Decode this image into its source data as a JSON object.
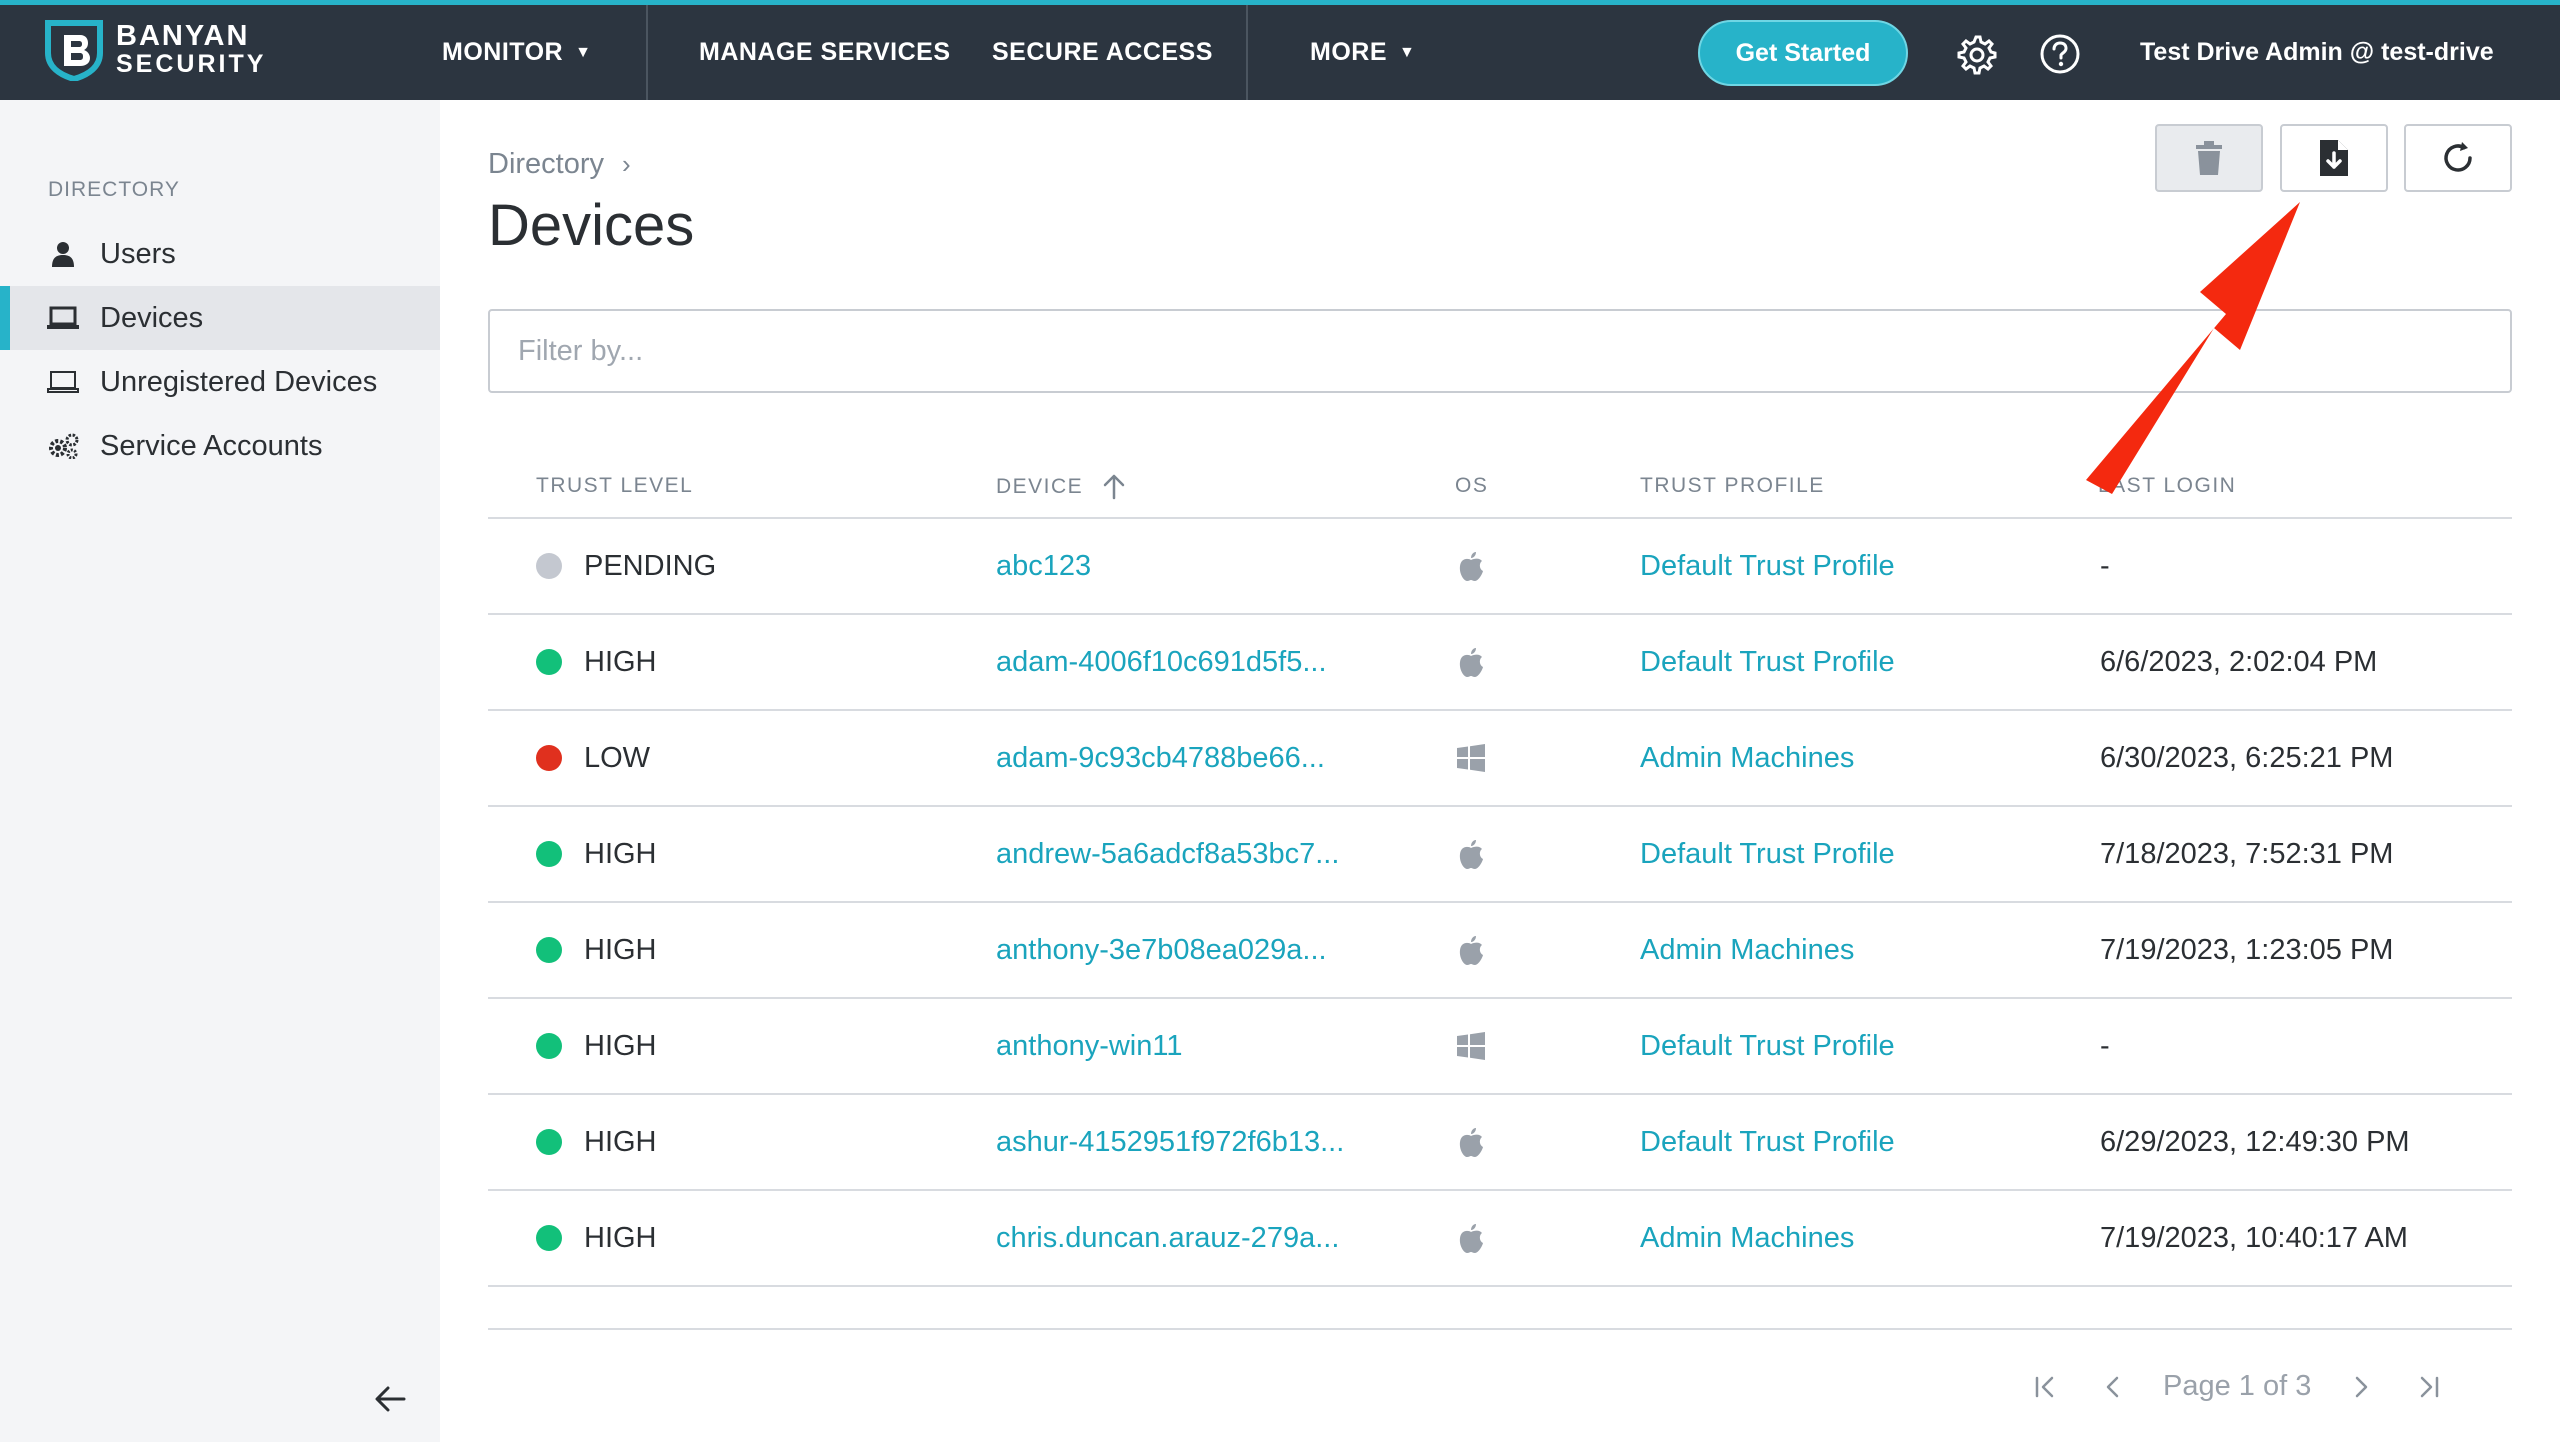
{
  "brand": {
    "line1": "BANYAN",
    "line2": "SECURITY"
  },
  "topnav": {
    "monitor": "MONITOR",
    "manage_services": "MANAGE SERVICES",
    "secure_access": "SECURE ACCESS",
    "more": "MORE",
    "get_started": "Get Started",
    "user": "Test Drive Admin @ test-drive"
  },
  "sidebar": {
    "heading": "DIRECTORY",
    "items": [
      {
        "label": "Users",
        "icon": "user-icon"
      },
      {
        "label": "Devices",
        "icon": "laptop-icon",
        "active": true
      },
      {
        "label": "Unregistered Devices",
        "icon": "laptop-outline-icon"
      },
      {
        "label": "Service Accounts",
        "icon": "gears-icon"
      }
    ]
  },
  "breadcrumb": {
    "parent": "Directory",
    "separator": "›"
  },
  "page_title": "Devices",
  "filter": {
    "placeholder": "Filter by...",
    "value": ""
  },
  "table": {
    "columns": [
      "TRUST LEVEL",
      "DEVICE",
      "OS",
      "TRUST PROFILE",
      "LAST LOGIN"
    ],
    "rows": [
      {
        "trust": "PENDING",
        "status_color": "#c4c8d0",
        "device": "abc123",
        "os": "apple",
        "profile": "Default Trust Profile",
        "last_login": "-"
      },
      {
        "trust": "HIGH",
        "status_color": "#12c07a",
        "device": "adam-4006f10c691d5f5...",
        "os": "apple",
        "profile": "Default Trust Profile",
        "last_login": "6/6/2023, 2:02:04 PM"
      },
      {
        "trust": "LOW",
        "status_color": "#e0301e",
        "device": "adam-9c93cb4788be66...",
        "os": "windows",
        "profile": "Admin Machines",
        "last_login": "6/30/2023, 6:25:21 PM"
      },
      {
        "trust": "HIGH",
        "status_color": "#12c07a",
        "device": "andrew-5a6adcf8a53bc7...",
        "os": "apple",
        "profile": "Default Trust Profile",
        "last_login": "7/18/2023, 7:52:31 PM"
      },
      {
        "trust": "HIGH",
        "status_color": "#12c07a",
        "device": "anthony-3e7b08ea029a...",
        "os": "apple",
        "profile": "Admin Machines",
        "last_login": "7/19/2023, 1:23:05 PM"
      },
      {
        "trust": "HIGH",
        "status_color": "#12c07a",
        "device": "anthony-win11",
        "os": "windows",
        "profile": "Default Trust Profile",
        "last_login": "-"
      },
      {
        "trust": "HIGH",
        "status_color": "#12c07a",
        "device": "ashur-4152951f972f6b13...",
        "os": "apple",
        "profile": "Default Trust Profile",
        "last_login": "6/29/2023, 12:49:30 PM"
      },
      {
        "trust": "HIGH",
        "status_color": "#12c07a",
        "device": "chris.duncan.arauz-279a...",
        "os": "apple",
        "profile": "Admin Machines",
        "last_login": "7/19/2023, 10:40:17 AM"
      }
    ]
  },
  "pagination": {
    "label": "Page 1 of 3"
  },
  "colors": {
    "accent": "#27b3c9",
    "topbar": "#2c3540",
    "link": "#1aa4bd",
    "annotation_arrow": "#f4290f"
  }
}
